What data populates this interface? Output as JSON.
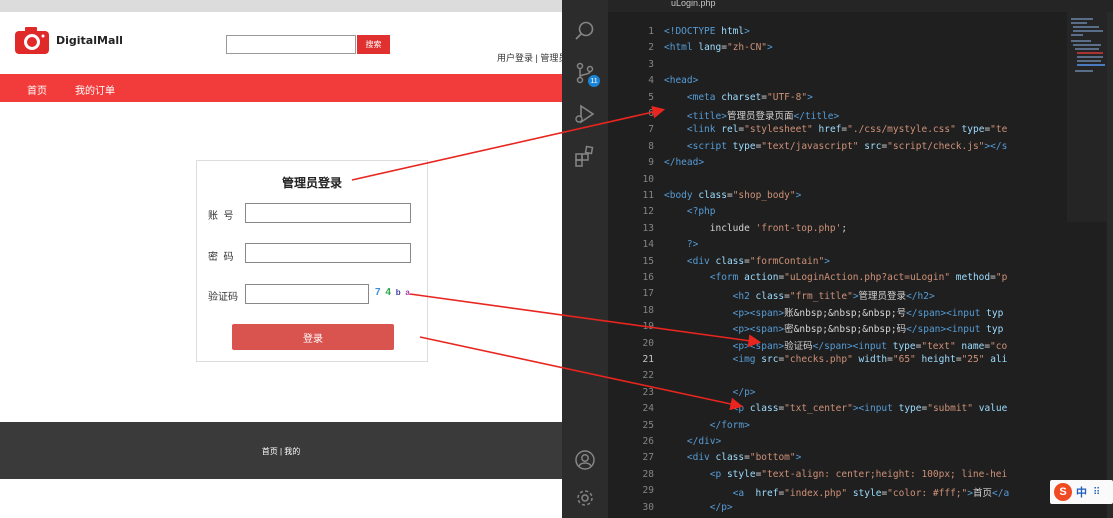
{
  "browser": {
    "logo_text": "DigitalMall",
    "search": {
      "placeholder": "",
      "button_label": "搜索"
    },
    "user_links": "用户登录 | 管理员",
    "nav": [
      "首页",
      "我的订单"
    ],
    "login": {
      "title": "管理员登录",
      "account_label": "账  号",
      "password_label": "密  码",
      "captcha_label": "验证码",
      "captcha_chars": [
        "7",
        "4",
        "b",
        "a"
      ],
      "submit_label": "登录"
    },
    "footer_links": "首页 | 我的"
  },
  "editor": {
    "tab_title": "uLogin.php",
    "active_line": 21,
    "badge_count": "11",
    "ime": {
      "logo": "S",
      "lang": "中",
      "extra": "⠿"
    },
    "lines": [
      {
        "n": "1",
        "h": "<span class='t'>&lt;!DOCTYPE</span> <span class='a'>html</span><span class='t'>&gt;</span>"
      },
      {
        "n": "2",
        "h": "<span class='t'>&lt;html</span> <span class='a'>lang</span>=<span class='s'>\"zh-CN\"</span><span class='t'>&gt;</span>"
      },
      {
        "n": "3",
        "h": ""
      },
      {
        "n": "4",
        "h": "<span class='t'>&lt;head&gt;</span>"
      },
      {
        "n": "5",
        "h": "    <span class='t'>&lt;meta</span> <span class='a'>charset</span>=<span class='s'>\"UTF-8\"</span><span class='t'>&gt;</span>"
      },
      {
        "n": "6",
        "h": "    <span class='t'>&lt;title&gt;</span>管理员登录页面<span class='t'>&lt;/title&gt;</span>"
      },
      {
        "n": "7",
        "h": "    <span class='t'>&lt;link</span> <span class='a'>rel</span>=<span class='s'>\"stylesheet\"</span> <span class='a'>href</span>=<span class='s'>\"./css/mystyle.css\"</span> <span class='a'>type</span>=<span class='s'>\"te</span>"
      },
      {
        "n": "8",
        "h": "    <span class='t'>&lt;script</span> <span class='a'>type</span>=<span class='s'>\"text/javascript\"</span> <span class='a'>src</span>=<span class='s'>\"script/check.js\"</span><span class='t'>&gt;&lt;/s</span>"
      },
      {
        "n": "9",
        "h": "<span class='t'>&lt;/head&gt;</span>"
      },
      {
        "n": "10",
        "h": ""
      },
      {
        "n": "11",
        "h": "<span class='t'>&lt;body</span> <span class='a'>class</span>=<span class='s'>\"shop_body\"</span><span class='t'>&gt;</span>"
      },
      {
        "n": "12",
        "h": "    <span class='t'>&lt;?php</span>"
      },
      {
        "n": "13",
        "h": "        <span class='w'>include</span> <span class='s'>'front-top.php'</span>;"
      },
      {
        "n": "14",
        "h": "    <span class='t'>?&gt;</span>"
      },
      {
        "n": "15",
        "h": "    <span class='t'>&lt;div</span> <span class='a'>class</span>=<span class='s'>\"formContain\"</span><span class='t'>&gt;</span>"
      },
      {
        "n": "16",
        "h": "        <span class='t'>&lt;form</span> <span class='a'>action</span>=<span class='s'>\"uLoginAction.php?act=uLogin\"</span> <span class='a'>method</span>=<span class='s'>\"p</span>"
      },
      {
        "n": "17",
        "h": "            <span class='t'>&lt;h2</span> <span class='a'>class</span>=<span class='s'>\"frm_title\"</span><span class='t'>&gt;</span>管理员登录<span class='t'>&lt;/h2&gt;</span>"
      },
      {
        "n": "18",
        "h": "            <span class='t'>&lt;p&gt;&lt;span&gt;</span>账&amp;nbsp;&amp;nbsp;&amp;nbsp;号<span class='t'>&lt;/span&gt;&lt;input</span> <span class='a'>typ</span>"
      },
      {
        "n": "19",
        "h": "            <span class='t'>&lt;p&gt;&lt;span&gt;</span>密&amp;nbsp;&amp;nbsp;&amp;nbsp;码<span class='t'>&lt;/span&gt;&lt;input</span> <span class='a'>typ</span>"
      },
      {
        "n": "20",
        "h": "            <span class='t'>&lt;p&gt;&lt;span&gt;</span>验证码<span class='t'>&lt;/span&gt;&lt;input</span> <span class='a'>type</span>=<span class='s'>\"text\"</span> <span class='a'>name</span>=<span class='s'>\"co</span>"
      },
      {
        "n": "21",
        "h": "            <span class='t'>&lt;img</span> <span class='a'>src</span>=<span class='s'>\"checks.php\"</span> <span class='a'>width</span>=<span class='s'>\"65\"</span> <span class='a'>height</span>=<span class='s'>\"25\"</span> <span class='a'>ali</span>"
      },
      {
        "n": "22",
        "h": ""
      },
      {
        "n": "23",
        "h": "            <span class='t'>&lt;/p&gt;</span>"
      },
      {
        "n": "24",
        "h": "            <span class='t'>&lt;p</span> <span class='a'>class</span>=<span class='s'>\"txt_center\"</span><span class='t'>&gt;&lt;input</span> <span class='a'>type</span>=<span class='s'>\"submit\"</span> <span class='a'>value</span>"
      },
      {
        "n": "25",
        "h": "        <span class='t'>&lt;/form&gt;</span>"
      },
      {
        "n": "26",
        "h": "    <span class='t'>&lt;/div&gt;</span>"
      },
      {
        "n": "27",
        "h": "    <span class='t'>&lt;div</span> <span class='a'>class</span>=<span class='s'>\"bottom\"</span><span class='t'>&gt;</span>"
      },
      {
        "n": "28",
        "h": "        <span class='t'>&lt;p</span> <span class='a'>style</span>=<span class='s'>\"text-align: center;height: 100px; line-hei</span>"
      },
      {
        "n": "29",
        "h": "            <span class='t'>&lt;a</span>  <span class='a'>href</span>=<span class='s'>\"index.php\"</span> <span class='a'>style</span>=<span class='s'>\"color: #fff;\"</span><span class='t'>&gt;</span>首页<span class='t'>&lt;/a</span>"
      },
      {
        "n": "30",
        "h": "        <span class='t'>&lt;/p&gt;</span>"
      }
    ]
  }
}
